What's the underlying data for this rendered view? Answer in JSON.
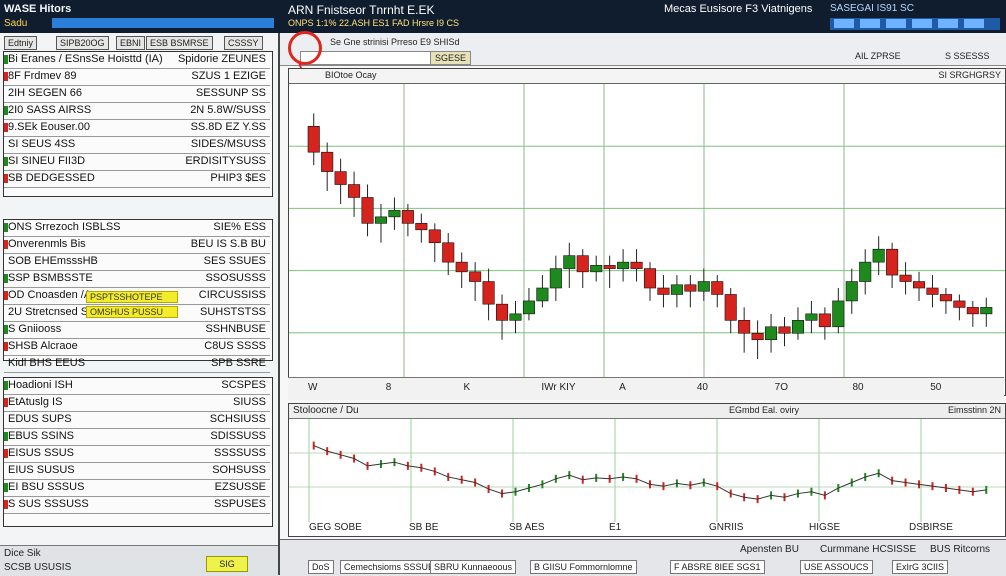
{
  "titlebar": {
    "app_title": "WASE Hitors",
    "subtitle": "Sadu",
    "center_title": "ARN Fnistseor   Tnrnht E.EK",
    "center_sub": "ONPS 1:1% 22.ASH  ES1  FAD  Hrsre  I9 CS",
    "right_title": "Mecas Eusisore  F3  Viatnigens",
    "right_sub": "SASEGAI IS91  SC"
  },
  "left_panel": {
    "tabs": [
      "Edtniy",
      "SIPB20OG",
      "EBNI",
      "ESB BSMRSE",
      "CSSSY"
    ],
    "watchlist1": [
      {
        "name": "Bi Eranes / ESnsSe Hoisttd (IA)",
        "value": "Spidorie ZEUNES"
      },
      {
        "name": "8F Frdmev 89",
        "value": "SZUS 1 EZIGE"
      },
      {
        "name": "2IH SEGEN 66",
        "value": "SESSUNP SS"
      },
      {
        "name": "2I0 SASS AIRSS",
        "value": "2N 5.8W/SUSS"
      },
      {
        "name": "9.SEk Eouser.00",
        "value": "SS.8D  EZ Y.SS"
      },
      {
        "name": "SI SEUS 4SS",
        "value": "SIDES/MSUSS"
      },
      {
        "name": "SI SINEU FII3D",
        "value": "ERDISITYSUSS"
      },
      {
        "name": "SB DEDGESSED",
        "value": "PHIP3  $ES"
      }
    ],
    "watchlist2": [
      {
        "name": "ONS Srrezoch ISBLSS",
        "value": "SIE% ESS"
      },
      {
        "name": "Onverenmls Bis",
        "value": "BEU IS S.B BU"
      },
      {
        "name": "SOB EHEmsssHB",
        "value": "SES SSUES"
      },
      {
        "name": "SSP BSMBSSTE",
        "value": "SSOSUSSS"
      },
      {
        "name": "OD Cnoasden /A",
        "value": "CIRCUSSISS"
      },
      {
        "name": "2U Stretcnsed SS",
        "value": "SUHSTSTSS"
      },
      {
        "name": "S  Gniiooss",
        "value": "SSHNBUSE"
      },
      {
        "name": "SHSB  Alcraoe",
        "value": "C8US SSSS"
      },
      {
        "name": "Kidl  BHS  EEUS",
        "value": "SPB SSRE"
      }
    ],
    "highlight1": "PSPTSSHOTEPE",
    "highlight2": "OMSHUS PUSSU",
    "watchlist3": [
      {
        "name": "Hoadioni ISH",
        "value": "SCSPES"
      },
      {
        "name": "EtAtuslg IS",
        "value": "SIUSS"
      },
      {
        "name": "EDUS SUPS",
        "value": "SCHSIUSS"
      },
      {
        "name": "EBUS SSINS",
        "value": "SDISSUSS"
      },
      {
        "name": "EISUS SSUS",
        "value": "SSSSUSS"
      },
      {
        "name": "EIUS  SUSUS",
        "value": "SOHSUSS"
      },
      {
        "name": "EI BSU SSSUS",
        "value": "EZSUSSE"
      },
      {
        "name": "S SUS SSSUSS",
        "value": "SSPUSES"
      }
    ],
    "footer_label": "Dice Sik",
    "footer_value": "SCSB USUSIS",
    "footer_button": "SIG"
  },
  "toolbar": {
    "line1": "Se Gne strinisi Prreso   E9 SHISd",
    "line2_btn": "SGESE",
    "right1": "AIL ZPRSE",
    "right2": "S SSESSS",
    "chart_label": "BIOtoe Ocay",
    "right3": "SI SRGHGRSY"
  },
  "chart_data": {
    "type": "candlestick",
    "ohlc": [
      [
        100,
        92,
        104,
        88
      ],
      [
        92,
        86,
        95,
        80
      ],
      [
        86,
        82,
        90,
        76
      ],
      [
        82,
        78,
        86,
        72
      ],
      [
        78,
        70,
        82,
        66
      ],
      [
        70,
        72,
        76,
        64
      ],
      [
        72,
        74,
        78,
        68
      ],
      [
        74,
        70,
        76,
        66
      ],
      [
        70,
        68,
        73,
        64
      ],
      [
        68,
        64,
        70,
        58
      ],
      [
        64,
        58,
        67,
        54
      ],
      [
        58,
        55,
        61,
        50
      ],
      [
        55,
        52,
        58,
        46
      ],
      [
        52,
        45,
        56,
        40
      ],
      [
        45,
        40,
        48,
        34
      ],
      [
        40,
        42,
        46,
        36
      ],
      [
        42,
        46,
        50,
        40
      ],
      [
        46,
        50,
        54,
        44
      ],
      [
        50,
        56,
        60,
        46
      ],
      [
        56,
        60,
        64,
        50
      ],
      [
        60,
        55,
        62,
        50
      ],
      [
        55,
        57,
        60,
        52
      ],
      [
        57,
        56,
        60,
        50
      ],
      [
        56,
        58,
        62,
        52
      ],
      [
        58,
        56,
        62,
        52
      ],
      [
        56,
        50,
        58,
        46
      ],
      [
        50,
        48,
        54,
        44
      ],
      [
        48,
        51,
        54,
        44
      ],
      [
        51,
        49,
        54,
        44
      ],
      [
        49,
        52,
        56,
        46
      ],
      [
        52,
        48,
        54,
        44
      ],
      [
        48,
        40,
        50,
        36
      ],
      [
        40,
        36,
        44,
        30
      ],
      [
        36,
        34,
        40,
        28
      ],
      [
        34,
        38,
        42,
        30
      ],
      [
        38,
        36,
        41,
        32
      ],
      [
        36,
        40,
        44,
        34
      ],
      [
        40,
        42,
        46,
        36
      ],
      [
        42,
        38,
        44,
        34
      ],
      [
        38,
        46,
        50,
        36
      ],
      [
        46,
        52,
        56,
        42
      ],
      [
        52,
        58,
        62,
        48
      ],
      [
        58,
        62,
        66,
        54
      ],
      [
        62,
        54,
        64,
        50
      ],
      [
        54,
        52,
        58,
        48
      ],
      [
        52,
        50,
        55,
        46
      ],
      [
        50,
        48,
        54,
        44
      ],
      [
        48,
        46,
        50,
        42
      ],
      [
        46,
        44,
        48,
        40
      ],
      [
        44,
        42,
        46,
        38
      ],
      [
        42,
        44,
        47,
        38
      ]
    ],
    "x_labels": [
      "W",
      "8",
      "K",
      "IWr KIY",
      "A",
      "40",
      "7O",
      "80",
      "50"
    ],
    "indicator_title": "Stoloocne / Du",
    "indicator_right": "EGmbd Eal.   oviry",
    "indicator_right2": "Eimsstinn 2N",
    "sub_x_labels": [
      "GEG SOBE",
      "SB BE",
      "SB AES",
      "E1",
      "GNRIIS",
      "HIGSE",
      "DSBIRSE"
    ]
  },
  "statusbar": {
    "label1": "Apensten BU",
    "label2": "Curmmane  HCSISSE",
    "label3": "BUS Ritcorns",
    "fields": [
      "DoS",
      "Cemechsioms SSSUE",
      "SBRU  Kunnaeoous",
      "B  GIISU  Fommornlomne",
      "F  ABSRE  8IEE  SGS1",
      "USE  ASSOUCS",
      "ExIrG  3CIIS"
    ]
  },
  "colors": {
    "up": "#1e8a1e",
    "down": "#d6231e",
    "accent": "#2c7fd8"
  }
}
